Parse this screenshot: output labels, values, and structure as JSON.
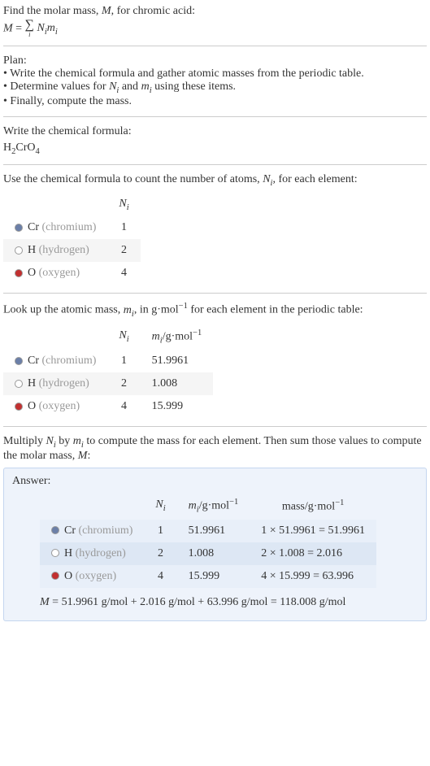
{
  "intro": {
    "line1_a": "Find the molar mass, ",
    "line1_b": ", for chromic acid:",
    "eq_left": "M",
    "eq_eq": " = ",
    "eq_sigma_sub": "i",
    "eq_right_a": " N",
    "eq_right_b": "m"
  },
  "plan": {
    "heading": "Plan:",
    "b1_a": "• Write the chemical formula and gather atomic masses from the periodic table.",
    "b2_a": "• Determine values for ",
    "b2_b": " and ",
    "b2_c": " using these items.",
    "b3": "• Finally, compute the mass."
  },
  "formula_section": {
    "heading": "Write the chemical formula:",
    "formula_main": "H",
    "formula_sub1": "2",
    "formula_mid": "CrO",
    "formula_sub2": "4"
  },
  "count_section": {
    "text_a": "Use the chemical formula to count the number of atoms, ",
    "text_b": ", for each element:"
  },
  "elements": [
    {
      "color": "#6b7fa8",
      "sym": "Cr",
      "name": "(chromium)",
      "N": "1",
      "m": "51.9961",
      "mass": "1 × 51.9961 = 51.9961"
    },
    {
      "color": "#ffffff",
      "sym": "H",
      "name": "(hydrogen)",
      "N": "2",
      "m": "1.008",
      "mass": "2 × 1.008 = 2.016"
    },
    {
      "color": "#c23030",
      "sym": "O",
      "name": "(oxygen)",
      "N": "4",
      "m": "15.999",
      "mass": "4 × 15.999 = 63.996"
    }
  ],
  "headers": {
    "Ni_a": "N",
    "Ni_b": "i",
    "mi_a": "m",
    "mi_b": "i",
    "mi_unit": "/g·mol",
    "mi_exp": "−1",
    "mass_a": "mass/g·mol",
    "mass_b": "−1"
  },
  "lookup_section": {
    "text_a": "Look up the atomic mass, ",
    "text_b": ", in g·mol",
    "text_c": " for each element in the periodic table:"
  },
  "multiply_section": {
    "text_a": "Multiply ",
    "text_b": " by ",
    "text_c": " to compute the mass for each element. Then sum those values to compute the molar mass, ",
    "text_d": ":"
  },
  "answer": {
    "label": "Answer:",
    "final_a": "M",
    "final_b": " = 51.9961 g/mol + 2.016 g/mol + 63.996 g/mol = 118.008 g/mol"
  }
}
